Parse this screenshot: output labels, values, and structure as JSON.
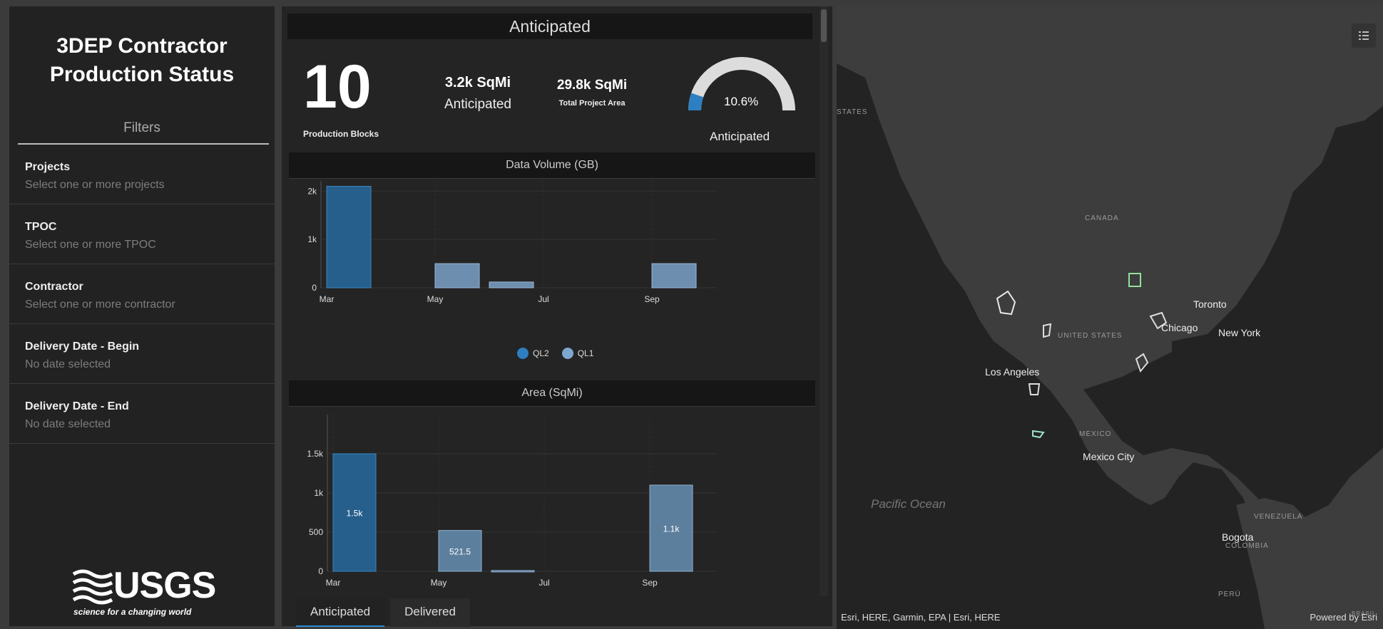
{
  "app": {
    "title_line1": "3DEP Contractor",
    "title_line2": "Production Status"
  },
  "filters": {
    "heading": "Filters",
    "items": [
      {
        "label": "Projects",
        "hint": "Select one or more projects"
      },
      {
        "label": "TPOC",
        "hint": "Select one or more TPOC"
      },
      {
        "label": "Contractor",
        "hint": "Select one or more contractor"
      },
      {
        "label": "Delivery Date - Begin",
        "hint": "No date selected"
      },
      {
        "label": "Delivery Date - End",
        "hint": "No date selected"
      }
    ]
  },
  "logo": {
    "word": "USGS",
    "tagline": "science for a changing world"
  },
  "summary": {
    "header": "Anticipated",
    "blocks_value": "10",
    "blocks_label": "Production Blocks",
    "anticipated_value": "3.2k SqMi",
    "anticipated_label": "Anticipated",
    "total_value": "29.8k SqMi",
    "total_label": "Total Project Area",
    "gauge_value": "10.6%",
    "gauge_fraction": 0.106,
    "gauge_label": "Anticipated"
  },
  "colors": {
    "ql2": "#2e7fc1",
    "ql1": "#7ea7cf",
    "bar_area": "#5f8db3",
    "gauge_fill": "#2e7fc1",
    "gauge_track": "#dcdcdc"
  },
  "chart_data": [
    {
      "type": "bar",
      "title": "Data Volume (GB)",
      "x_ticks": [
        "Mar",
        "May",
        "Jul",
        "Sep"
      ],
      "y_ticks": [
        "0",
        "1k",
        "2k"
      ],
      "ylim": [
        0,
        2800
      ],
      "series": [
        {
          "name": "QL2",
          "bars": [
            {
              "date": "Mar",
              "value": 2100
            }
          ]
        },
        {
          "name": "QL1",
          "bars": [
            {
              "date": "May",
              "value": 500
            },
            {
              "date": "Jun",
              "value": 120
            },
            {
              "date": "Sep",
              "value": 500
            }
          ]
        }
      ],
      "legend": [
        "QL2",
        "QL1"
      ],
      "legend_position": "bottom"
    },
    {
      "type": "bar",
      "title": "Area (SqMi)",
      "x_ticks": [
        "Mar",
        "May",
        "Jul",
        "Sep"
      ],
      "y_ticks": [
        "0",
        "500",
        "1k",
        "1.5k"
      ],
      "ylim": [
        0,
        2000
      ],
      "bars": [
        {
          "date": "Mar",
          "value": 1500,
          "label": "1.5k",
          "series": "QL2"
        },
        {
          "date": "May",
          "value": 521.5,
          "label": "521.5",
          "series": "QL1"
        },
        {
          "date": "Jun",
          "value": 10,
          "label": "",
          "series": "QL1"
        },
        {
          "date": "Sep",
          "value": 1100,
          "label": "1.1k",
          "series": "QL1"
        }
      ]
    }
  ],
  "tabs": [
    {
      "label": "Anticipated",
      "active": true
    },
    {
      "label": "Delivered",
      "active": false
    }
  ],
  "map": {
    "labels": {
      "canada": "CANADA",
      "united_states": "UNITED STATES",
      "states": "STATES",
      "mexico": "MEXICO",
      "venezuela": "VENEZUELA",
      "colombia": "COLOMBIA",
      "peru": "PERÚ",
      "brazil": "BRASIL"
    },
    "cities": {
      "toronto": "Toronto",
      "chicago": "Chicago",
      "new_york": "New York",
      "los_angeles": "Los Angeles",
      "mexico_city": "Mexico City",
      "bogota": "Bogota"
    },
    "ocean": "Pacific Ocean",
    "attribution": "Esri, HERE, Garmin, EPA | Esri, HERE",
    "powered_by": "Powered by Esri"
  }
}
